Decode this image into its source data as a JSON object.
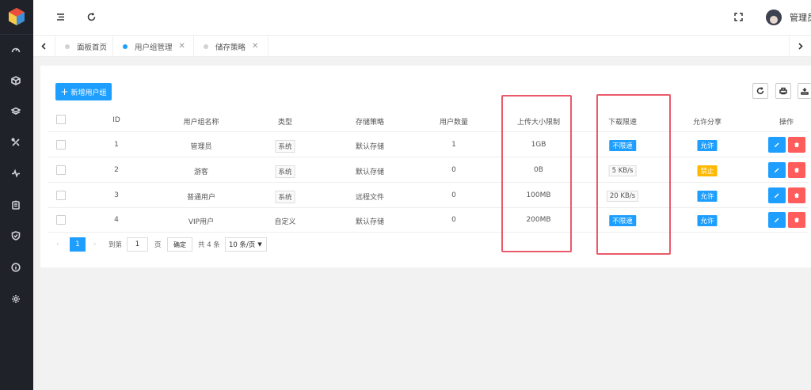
{
  "header": {
    "username": "管理员"
  },
  "tabs": [
    {
      "label": "面板首页"
    },
    {
      "label": "用户组管理"
    },
    {
      "label": "储存策略"
    }
  ],
  "toolbar": {
    "add_label": "新增用户组"
  },
  "table": {
    "columns": [
      "ID",
      "用户组名称",
      "类型",
      "存储策略",
      "用户数量",
      "上传大小限制",
      "下载限速",
      "允许分享",
      "操作"
    ],
    "rows": [
      {
        "id": "1",
        "name": "管理员",
        "type": "系统",
        "policy": "默认存储",
        "users": "1",
        "upload": "1GB",
        "speed": "不限速",
        "share": "允许"
      },
      {
        "id": "2",
        "name": "游客",
        "type": "系统",
        "policy": "默认存储",
        "users": "0",
        "upload": "0B",
        "speed": "5 KB/s",
        "share": "禁止"
      },
      {
        "id": "3",
        "name": "普通用户",
        "type": "系统",
        "policy": "远程文件",
        "users": "0",
        "upload": "100MB",
        "speed": "20 KB/s",
        "share": "允许"
      },
      {
        "id": "4",
        "name": "VIP用户",
        "type": "自定义",
        "policy": "默认存储",
        "users": "0",
        "upload": "200MB",
        "speed": "不限速",
        "share": "允许"
      }
    ]
  },
  "pagination": {
    "current_page": "1",
    "goto_label": "到第",
    "goto_value": "1",
    "page_label": "页",
    "confirm_label": "确定",
    "total_label": "共 4 条",
    "page_size": "10 条/页"
  },
  "colors": {
    "primary": "#1e9fff",
    "danger": "#ff5c5c",
    "warning": "#ffb800",
    "sidebar": "#20222a",
    "highlight": "#ea5a6a"
  }
}
